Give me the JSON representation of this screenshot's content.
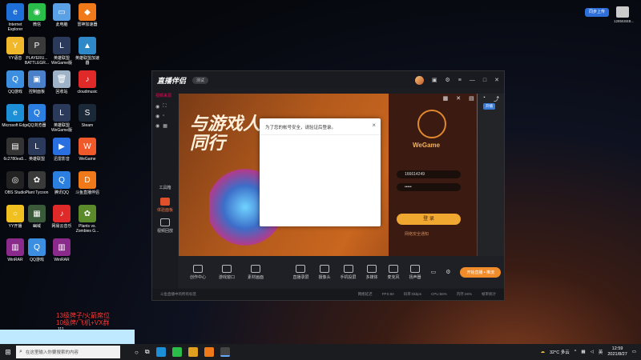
{
  "desktop": {
    "icons": [
      {
        "label": "Internet Explorer",
        "color": "#1e6fd8",
        "glyph": "e"
      },
      {
        "label": "微信",
        "color": "#2bbd4a",
        "glyph": "◉"
      },
      {
        "label": "此电脑",
        "color": "#5aa0e6",
        "glyph": "▭"
      },
      {
        "label": "雷神加速器",
        "color": "#f07a1a",
        "glyph": "◆"
      },
      {
        "label": "YY语音",
        "color": "#f0b82a",
        "glyph": "Y"
      },
      {
        "label": "PLAYERU... BATTLEGR...",
        "color": "#3a3a3a",
        "glyph": "P"
      },
      {
        "label": "英雄联盟 WeGame版",
        "color": "#2b3a5a",
        "glyph": "L"
      },
      {
        "label": "英雄联盟加速器",
        "color": "#2f89c9",
        "glyph": "▲"
      },
      {
        "label": "QQ游戏",
        "color": "#3c8fe0",
        "glyph": "Q"
      },
      {
        "label": "控制面板",
        "color": "#4a7fc9",
        "glyph": "▣"
      },
      {
        "label": "回收站",
        "color": "#9fb3c8",
        "glyph": "🗑"
      },
      {
        "label": "cloudmusic",
        "color": "#e02a2a",
        "glyph": "♪"
      },
      {
        "label": "Microsoft Edge",
        "color": "#1d8fd6",
        "glyph": "e"
      },
      {
        "label": "QQ浏览器",
        "color": "#2a7fe0",
        "glyph": "Q"
      },
      {
        "label": "英雄联盟 WeGame版",
        "color": "#2b3a5a",
        "glyph": "L"
      },
      {
        "label": "Steam",
        "color": "#1b2838",
        "glyph": "S"
      },
      {
        "label": "6c2780ea5...",
        "color": "#333",
        "glyph": "▤"
      },
      {
        "label": "英雄联盟",
        "color": "#2b3a5a",
        "glyph": "L"
      },
      {
        "label": "迅雷影音",
        "color": "#2a6fe0",
        "glyph": "▶"
      },
      {
        "label": "WeGame",
        "color": "#f05a2a",
        "glyph": "W"
      },
      {
        "label": "OBS Studio",
        "color": "#222",
        "glyph": "◎"
      },
      {
        "label": "Plant Tycoon",
        "color": "#3a3a3a",
        "glyph": "✿"
      },
      {
        "label": "腾讯QQ",
        "color": "#2a7fe0",
        "glyph": "Q"
      },
      {
        "label": "斗鱼直播伴侣",
        "color": "#f07a1a",
        "glyph": "D"
      },
      {
        "label": "YY开播",
        "color": "#f0c020",
        "glyph": "○"
      },
      {
        "label": "幽域",
        "color": "#3a5a3a",
        "glyph": "▦"
      },
      {
        "label": "网易云音乐",
        "color": "#e02a2a",
        "glyph": "♪"
      },
      {
        "label": "Plants vs. Zombies G...",
        "color": "#5a8a2a",
        "glyph": "✿"
      },
      {
        "label": "WinRAR",
        "color": "#8a2a8a",
        "glyph": "▥"
      },
      {
        "label": "QQ游戏",
        "color": "#3c8fe0",
        "glyph": "Q"
      },
      {
        "label": "WinRAR",
        "color": "#8a2a8a",
        "glyph": "▥"
      }
    ],
    "overlay_line1": "13级牌子/火箭席位",
    "overlay_line2": "10级牌/飞机+VX群",
    "overlay_extra": "111",
    "top_right": {
      "btn_label": "同步上传",
      "icon_label": "12855SEB..."
    }
  },
  "app": {
    "logo": "直播伴侣",
    "beta_label": "测试",
    "side": {
      "source_label": "视频来源",
      "items": [
        {
          "label": "工具箱"
        },
        {
          "label": "体验面板"
        },
        {
          "label": "视频回放"
        }
      ]
    },
    "promo_line1": "与游戏人",
    "promo_line2": "同行",
    "login": {
      "brand": "WeGame",
      "account": "166614249",
      "password_placeholder": "•••••",
      "login_button": "登 录",
      "link": "网络安全通知"
    },
    "square_btn": "开播",
    "toolbar_left": [
      {
        "label": "创作中心"
      },
      {
        "label": "游戏窗口"
      },
      {
        "label": "素材画面"
      }
    ],
    "toolbar_right": [
      {
        "label": "直播录屏"
      },
      {
        "label": "摄像头"
      },
      {
        "label": "手机投屏"
      },
      {
        "label": "多媒体"
      },
      {
        "label": "麦克风"
      },
      {
        "label": "扬声器"
      }
    ],
    "start_live_button": "开始直播 • 推流",
    "status_left": "斗鱼直播中的所有标签",
    "status_stats": [
      "网络延迟",
      "FPS:60",
      "码率:0kbps",
      "CPU:56%",
      "内存:46%",
      "帧率统计"
    ]
  },
  "dialog": {
    "message": "为了您的帐号安全，请验证后登录。",
    "close": "×"
  },
  "taskbar": {
    "search_placeholder": "在这里输入你要搜索的内容",
    "weather": "32°C 多云",
    "time": "12:59",
    "date": "2021/8/27"
  }
}
